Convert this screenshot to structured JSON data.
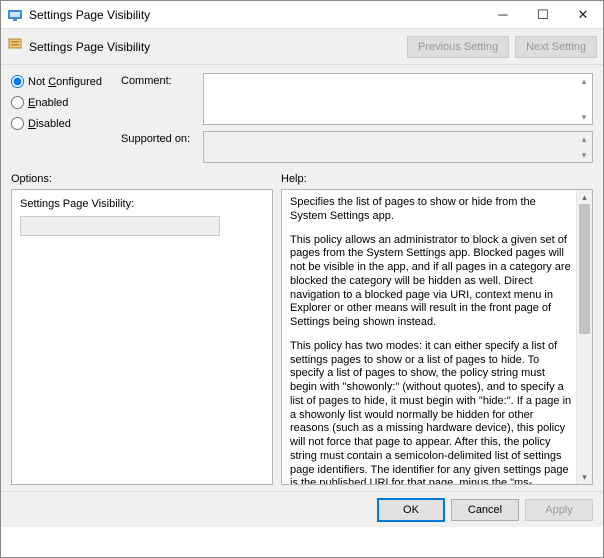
{
  "window": {
    "title": "Settings Page Visibility"
  },
  "subheader": {
    "title": "Settings Page Visibility",
    "prev": "Previous Setting",
    "next": "Next Setting"
  },
  "state": {
    "options": [
      {
        "label": "Not Configured",
        "underline_html": "Not <u>C</u>onfigured",
        "checked": true
      },
      {
        "label": "Enabled",
        "underline_html": "<u>E</u>nabled",
        "checked": false
      },
      {
        "label": "Disabled",
        "underline_html": "<u>D</u>isabled",
        "checked": false
      }
    ]
  },
  "fields": {
    "comment_label": "Comment:",
    "comment_value": "",
    "supported_label": "Supported on:",
    "supported_value": ""
  },
  "section_labels": {
    "options": "Options:",
    "help": "Help:"
  },
  "options_panel": {
    "label": "Settings Page Visibility:",
    "value": ""
  },
  "help": {
    "p1": "Specifies the list of pages to show or hide from the System Settings app.",
    "p2": "This policy allows an administrator to block a given set of pages from the System Settings app. Blocked pages will not be visible in the app, and if all pages in a category are blocked the category will be hidden as well. Direct navigation to a blocked page via URI, context menu in Explorer or other means will result in the front page of Settings being shown instead.",
    "p3": "This policy has two modes: it can either specify a list of settings pages to show or a list of pages to hide. To specify a list of pages to show, the policy string must begin with \"showonly:\" (without quotes), and to specify a list of pages to hide, it must begin with \"hide:\". If a page in a showonly list would normally be hidden for other reasons (such as a missing hardware device), this policy will not force that page to appear. After this, the policy string must contain a semicolon-delimited list of settings page identifiers. The identifier for any given settings page is the published URI for that page, minus the \"ms-settings:\" protocol part."
  },
  "footer": {
    "ok": "OK",
    "cancel": "Cancel",
    "apply": "Apply"
  }
}
